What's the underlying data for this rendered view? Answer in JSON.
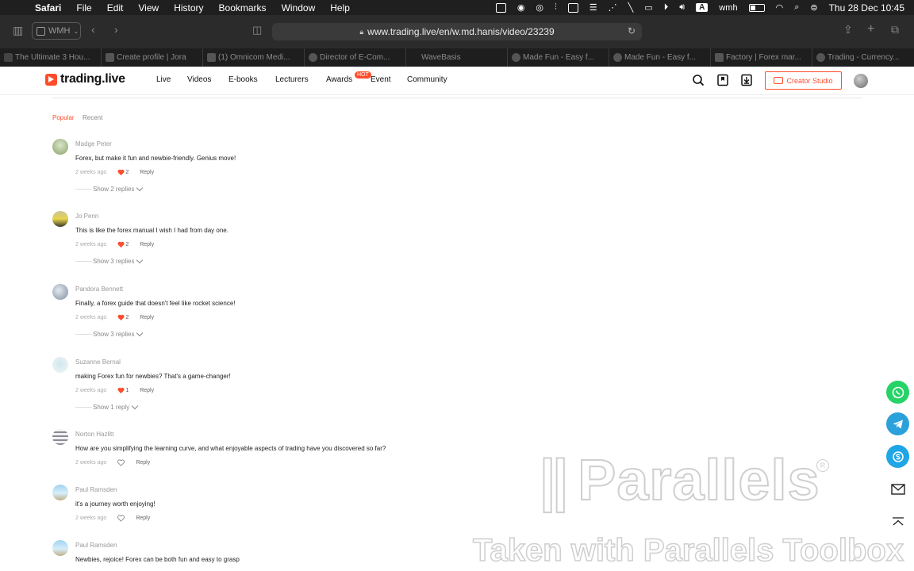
{
  "menubar": {
    "app": "Safari",
    "items": [
      "File",
      "Edit",
      "View",
      "History",
      "Bookmarks",
      "Window",
      "Help"
    ],
    "status": {
      "input_source": "A",
      "user": "wmh",
      "clock": "Thu 28 Dec  10:45"
    }
  },
  "toolbar": {
    "profile": "WMH",
    "url": "www.trading.live/en/w.md.hanis/video/23239"
  },
  "tabs": [
    {
      "title": "The Ultimate 3 Hou..."
    },
    {
      "title": "Create profile | Jora"
    },
    {
      "title": "(1) Omnicom Medi..."
    },
    {
      "title": "Director of E-Com..."
    },
    {
      "title": "WaveBasis"
    },
    {
      "title": "Made Fun - Easy f..."
    },
    {
      "title": "Made Fun - Easy f..."
    },
    {
      "title": "Factory | Forex mar..."
    },
    {
      "title": "Trading - Currency..."
    }
  ],
  "site": {
    "logo": "trading.live",
    "nav": [
      "Live",
      "Videos",
      "E-books",
      "Lecturers",
      "Awards",
      "Event",
      "Community"
    ],
    "hot_badge": "HOT",
    "creator_button": "Creator Studio"
  },
  "sort": {
    "popular": "Popular",
    "recent": "Recent"
  },
  "comments": [
    {
      "author": "Madge Peter",
      "text": "Forex, but make it fun and newbie-friendly. Genius move!",
      "time": "2 weeks ago",
      "likes": "2",
      "liked": true,
      "reply": "Reply",
      "replies": "Show 2 replies"
    },
    {
      "author": "Jo Penn",
      "text": "This is like the forex manual I wish I had from day one.",
      "time": "2 weeks ago",
      "likes": "2",
      "liked": true,
      "reply": "Reply",
      "replies": "Show 3 replies"
    },
    {
      "author": "Pandora Bennett",
      "text": "Finally, a forex guide that doesn't feel like rocket science!",
      "time": "2 weeks ago",
      "likes": "2",
      "liked": true,
      "reply": "Reply",
      "replies": "Show 3 replies"
    },
    {
      "author": "Suzanne Bernal",
      "text": "making Forex fun for newbies? That's a game-changer!",
      "time": "2 weeks ago",
      "likes": "1",
      "liked": true,
      "reply": "Reply",
      "replies": "Show 1 reply"
    },
    {
      "author": "Norton Hazlitt",
      "text": "How are you simplifying the learning curve, and what enjoyable aspects of trading have you discovered so far?",
      "time": "2 weeks ago",
      "likes": "",
      "liked": false,
      "reply": "Reply",
      "replies": ""
    },
    {
      "author": "Paul Ramsden",
      "text": "it's a journey worth enjoying!",
      "time": "2 weeks ago",
      "likes": "",
      "liked": false,
      "reply": "Reply",
      "replies": ""
    },
    {
      "author": "Paul Ramsden",
      "text": "Newbies, rejoice! Forex can be both fun and easy to grasp",
      "time": "",
      "likes": "",
      "liked": false,
      "reply": "",
      "replies": ""
    }
  ],
  "watermark": {
    "brand": "Parallels",
    "reg": "R",
    "caption": "Taken with Parallels Toolbox"
  },
  "colors": {
    "accent": "#ff4d2b",
    "whatsapp": "#25d366",
    "telegram": "#2aa1da",
    "skype": "#1ea6e6"
  }
}
